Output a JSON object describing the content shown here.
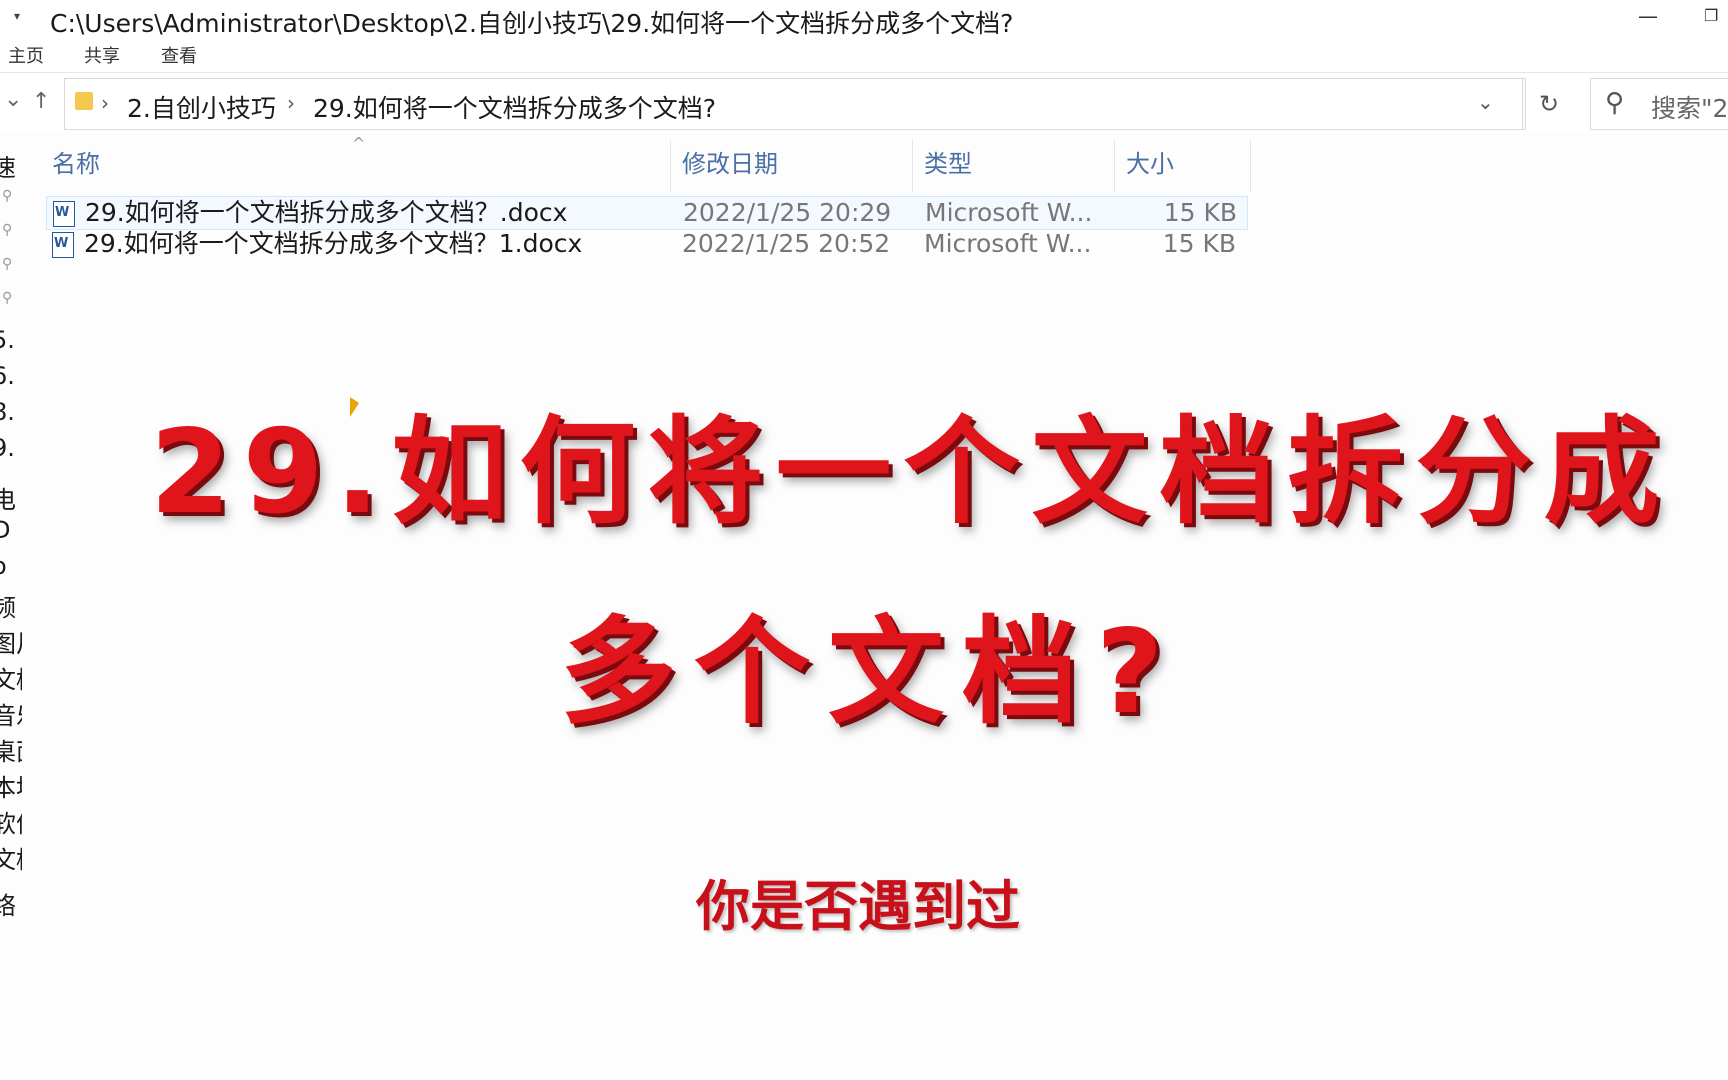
{
  "window": {
    "title_path": "C:\\Users\\Administrator\\Desktop\\2.自创小技巧\\29.如何将一个文档拆分成多个文档?"
  },
  "ribbon": {
    "tabs": [
      "主页",
      "共享",
      "查看"
    ]
  },
  "address": {
    "crumbs": [
      "2.自创小技巧",
      "29.如何将一个文档拆分成多个文档?"
    ]
  },
  "search": {
    "placeholder": "搜索\"2"
  },
  "sidebar": {
    "items": [
      "速",
      "5.",
      "6.",
      "8.",
      "9.",
      "电",
      "D",
      "o",
      "频",
      "图片",
      "文档",
      "音乐",
      "桌面",
      "本地",
      "软件",
      "文档",
      "络"
    ]
  },
  "filelist": {
    "columns": {
      "name": "名称",
      "date": "修改日期",
      "type": "类型",
      "size": "大小"
    },
    "rows": [
      {
        "name": "29.如何将一个文档拆分成多个文档？.docx",
        "date": "2022/1/25 20:29",
        "type": "Microsoft W...",
        "size": "15 KB"
      },
      {
        "name": "29.如何将一个文档拆分成多个文档？1.docx",
        "date": "2022/1/25 20:52",
        "type": "Microsoft W...",
        "size": "15 KB"
      }
    ]
  },
  "overlay": {
    "line1": "29.如何将一个文档拆分成",
    "line2": "多个文档?",
    "subtitle": "你是否遇到过"
  },
  "colors": {
    "overlay_red": "#e0141b",
    "column_header_blue": "#4a6fa5"
  }
}
